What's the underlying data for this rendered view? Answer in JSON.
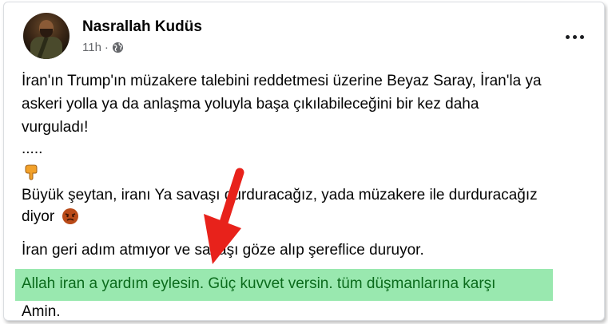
{
  "post": {
    "author": "Nasrallah Kudüs",
    "time": "11h",
    "dot": "·",
    "lines": {
      "l1": "İran'ın Trump'ın müzakere talebini reddetmesi üzerine Beyaz Saray, İran'la ya",
      "l2": "askeri yolla ya da anlaşma yoluyla başa çıkılabileceğini bir kez daha",
      "l3": "vurguladı!",
      "l4": ".....",
      "l5": "Büyük şeytan, iranı Ya savaşı durduracağız, yada müzakere ile durduracağız",
      "l6": "diyor",
      "l7": "İran geri adım atmıyor ve savaşı göze alıp şereflice duruyor.",
      "l8": "Allah iran a yardım eylesin. Güç kuvvet versin. tüm düşmanlarına karşı",
      "l9": "Amin."
    }
  },
  "icons": {
    "privacy": "globe-icon",
    "emoji1": "point-down-icon",
    "emoji2": "angry-face-icon",
    "menu": "more-options-icon"
  },
  "colors": {
    "highlight": "#8ee6a6",
    "highlight_text": "#0b6b1c",
    "arrow": "#e8221b"
  }
}
